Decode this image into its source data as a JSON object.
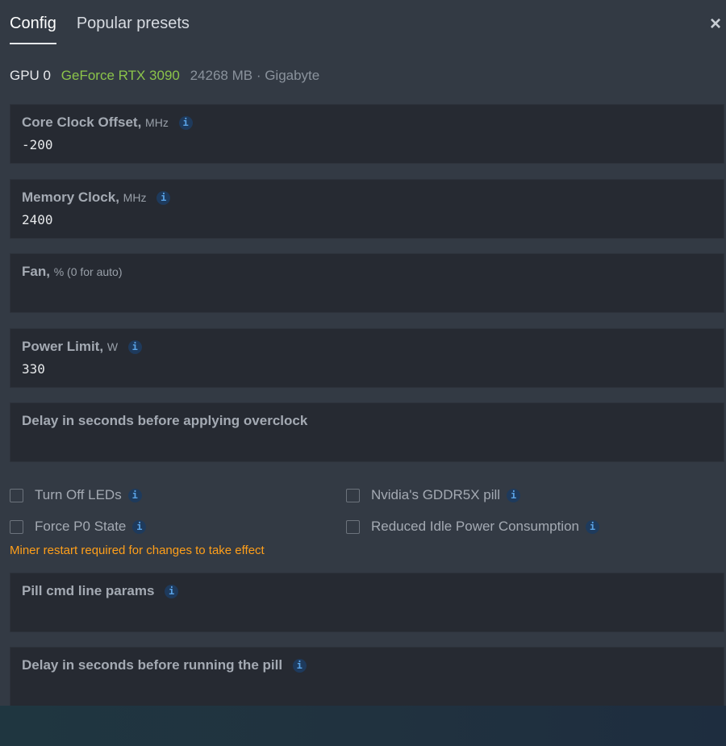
{
  "tabs": [
    {
      "label": "Config",
      "active": true
    },
    {
      "label": "Popular presets",
      "active": false
    }
  ],
  "close_icon": "×",
  "gpu": {
    "index_label": "GPU 0",
    "model": "GeForce RTX 3090",
    "details": "24268 MB · Gigabyte"
  },
  "fields": {
    "core_clock": {
      "label": "Core Clock Offset,",
      "unit": "MHz",
      "value": "-200"
    },
    "memory_clock": {
      "label": "Memory Clock,",
      "unit": "MHz",
      "value": "2400"
    },
    "fan": {
      "label": "Fan,",
      "unit": "% (0 for auto)",
      "value": ""
    },
    "power_limit": {
      "label": "Power Limit,",
      "unit": "W",
      "value": "330"
    },
    "delay_overclock": {
      "label": "Delay in seconds before applying overclock",
      "value": ""
    },
    "pill_params": {
      "label": "Pill cmd line params",
      "value": ""
    },
    "delay_pill": {
      "label": "Delay in seconds before running the pill",
      "value": ""
    }
  },
  "checkboxes": {
    "turn_off_leds": {
      "label": "Turn Off LEDs",
      "checked": false
    },
    "gddr5x_pill": {
      "label": "Nvidia's GDDR5X pill",
      "checked": false
    },
    "force_p0": {
      "label": "Force P0 State",
      "checked": false
    },
    "reduced_idle": {
      "label": "Reduced Idle Power Consumption",
      "checked": false
    }
  },
  "info_icon_glyph": "i",
  "warning": "Miner restart required for changes to take effect",
  "colors": {
    "accent_green": "#8bc34a",
    "warning_orange": "#ff9f1a",
    "info_blue": "#5aa3e6"
  }
}
